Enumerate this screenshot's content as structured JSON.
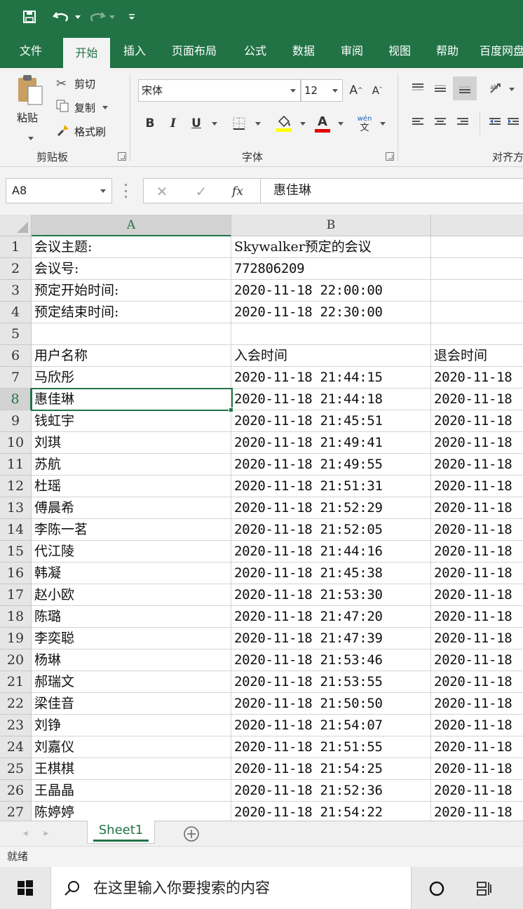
{
  "ribbon_tabs": [
    "文件",
    "开始",
    "插入",
    "页面布局",
    "公式",
    "数据",
    "审阅",
    "视图",
    "帮助",
    "百度网盘"
  ],
  "active_tab": "开始",
  "clipboard": {
    "paste": "粘贴",
    "cut": "剪切",
    "copy": "复制",
    "format_painter": "格式刷",
    "group_label": "剪贴板"
  },
  "font": {
    "name": "宋体",
    "size": "12",
    "bold": "B",
    "italic": "I",
    "underline": "U",
    "font_color_letter": "A",
    "wen": "wén",
    "wen_char": "文",
    "group_label": "字体",
    "grow": "A",
    "shrink": "A"
  },
  "alignment": {
    "group_label": "对齐方"
  },
  "formula_bar": {
    "name_box": "A8",
    "fx": "fx",
    "value": "惠佳琳"
  },
  "columns": [
    "A",
    "B"
  ],
  "selected_cell": "A8",
  "rows": [
    {
      "n": "1",
      "a": "会议主题:",
      "b": "Skywalker预定的会议",
      "c": ""
    },
    {
      "n": "2",
      "a": "会议号:",
      "b": "772806209",
      "c": ""
    },
    {
      "n": "3",
      "a": "预定开始时间:",
      "b": "2020-11-18 22:00:00",
      "c": ""
    },
    {
      "n": "4",
      "a": "预定结束时间:",
      "b": "2020-11-18 22:30:00",
      "c": ""
    },
    {
      "n": "5",
      "a": "",
      "b": "",
      "c": ""
    },
    {
      "n": "6",
      "a": "用户名称",
      "b": "入会时间",
      "c": "退会时间"
    },
    {
      "n": "7",
      "a": "马欣彤",
      "b": "2020-11-18 21:44:15",
      "c": "2020-11-18"
    },
    {
      "n": "8",
      "a": "惠佳琳",
      "b": "2020-11-18 21:44:18",
      "c": "2020-11-18"
    },
    {
      "n": "9",
      "a": "钱虹宇",
      "b": "2020-11-18 21:45:51",
      "c": "2020-11-18"
    },
    {
      "n": "10",
      "a": "刘琪",
      "b": "2020-11-18 21:49:41",
      "c": "2020-11-18"
    },
    {
      "n": "11",
      "a": "苏航",
      "b": "2020-11-18 21:49:55",
      "c": "2020-11-18"
    },
    {
      "n": "12",
      "a": "杜瑶",
      "b": "2020-11-18 21:51:31",
      "c": "2020-11-18"
    },
    {
      "n": "13",
      "a": "傅晨希",
      "b": "2020-11-18 21:52:29",
      "c": "2020-11-18"
    },
    {
      "n": "14",
      "a": "李陈一茗",
      "b": "2020-11-18 21:52:05",
      "c": "2020-11-18"
    },
    {
      "n": "15",
      "a": "代江陵",
      "b": "2020-11-18 21:44:16",
      "c": "2020-11-18"
    },
    {
      "n": "16",
      "a": "韩凝",
      "b": "2020-11-18 21:45:38",
      "c": "2020-11-18"
    },
    {
      "n": "17",
      "a": "赵小欧",
      "b": "2020-11-18 21:53:30",
      "c": "2020-11-18"
    },
    {
      "n": "18",
      "a": "陈璐",
      "b": "2020-11-18 21:47:20",
      "c": "2020-11-18"
    },
    {
      "n": "19",
      "a": "李奕聪",
      "b": "2020-11-18 21:47:39",
      "c": "2020-11-18"
    },
    {
      "n": "20",
      "a": "杨琳",
      "b": "2020-11-18 21:53:46",
      "c": "2020-11-18"
    },
    {
      "n": "21",
      "a": "郝瑞文",
      "b": "2020-11-18 21:53:55",
      "c": "2020-11-18"
    },
    {
      "n": "22",
      "a": "梁佳音",
      "b": "2020-11-18 21:50:50",
      "c": "2020-11-18"
    },
    {
      "n": "23",
      "a": "刘铮",
      "b": "2020-11-18 21:54:07",
      "c": "2020-11-18"
    },
    {
      "n": "24",
      "a": "刘嘉仪",
      "b": "2020-11-18 21:51:55",
      "c": "2020-11-18"
    },
    {
      "n": "25",
      "a": "王棋棋",
      "b": "2020-11-18 21:54:25",
      "c": "2020-11-18"
    },
    {
      "n": "26",
      "a": "王晶晶",
      "b": "2020-11-18 21:52:36",
      "c": "2020-11-18"
    },
    {
      "n": "27",
      "a": "陈婷婷",
      "b": "2020-11-18 21:54:22",
      "c": "2020-11-18"
    }
  ],
  "sheet_tab": "Sheet1",
  "status": "就绪",
  "taskbar": {
    "search_placeholder": "在这里输入你要搜索的内容"
  },
  "colors": {
    "accent": "#217346",
    "font_color_bar": "#e00000",
    "highlight_bar": "#ffff00"
  }
}
